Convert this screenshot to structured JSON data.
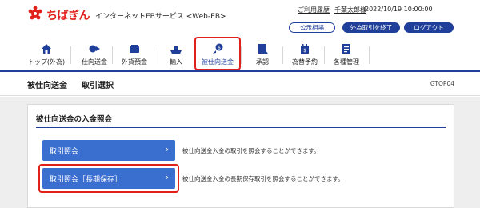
{
  "header": {
    "bank_name": "ちばぎん",
    "service_name": "インターネットEBサービス <Web-EB>",
    "usage_history_link": "ご利用履歴",
    "user_name": "千葉太郎様",
    "datetime": "2022/10/19 10:00:00",
    "buttons": {
      "public_rates": "公示相場",
      "end_fx": "外為取引を終了",
      "logout": "ログアウト"
    },
    "brand_color": "#e0201b",
    "accent_color": "#1f3f9a"
  },
  "nav": {
    "items": [
      {
        "label": "トップ(外為)",
        "icon": "home-icon"
      },
      {
        "label": "仕向送金",
        "icon": "outward-remittance-icon"
      },
      {
        "label": "外貨預金",
        "icon": "foreign-deposit-icon"
      },
      {
        "label": "輸入",
        "icon": "import-icon"
      },
      {
        "label": "被仕向送金",
        "icon": "inward-remittance-icon"
      },
      {
        "label": "承認",
        "icon": "approval-icon"
      },
      {
        "label": "為替予約",
        "icon": "forward-contract-icon"
      },
      {
        "label": "各種管理",
        "icon": "management-icon"
      }
    ],
    "active_index": 4
  },
  "breadcrumb": {
    "section": "被仕向送金",
    "page": "取引選択",
    "screen_id": "GTOP04"
  },
  "panel": {
    "title": "被仕向送金の入金照会",
    "items": [
      {
        "label": "取引照会",
        "description": "被仕向送金入金の取引を照会することができます。"
      },
      {
        "label": "取引照会［長期保存］",
        "description": "被仕向送金入金の長期保存取引を照会することができます。"
      }
    ]
  }
}
